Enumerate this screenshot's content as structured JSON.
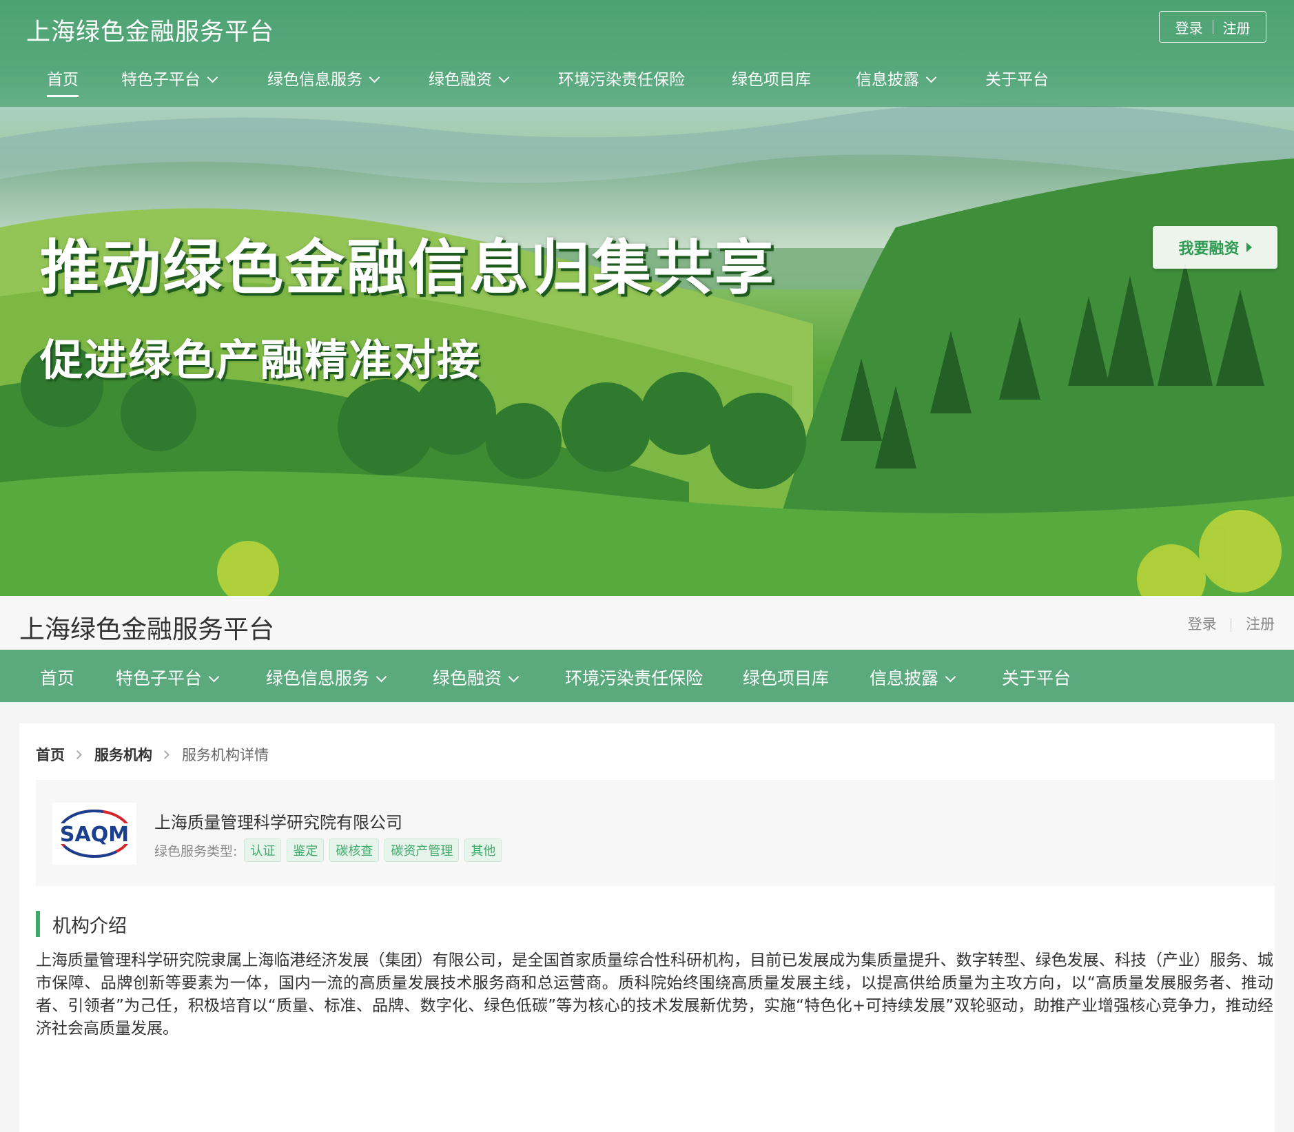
{
  "site": {
    "title": "上海绿色金融服务平台",
    "login": "登录",
    "register": "注册"
  },
  "nav": {
    "items": [
      {
        "label": "首页",
        "dropdown": false
      },
      {
        "label": "特色子平台",
        "dropdown": true
      },
      {
        "label": "绿色信息服务",
        "dropdown": true
      },
      {
        "label": "绿色融资",
        "dropdown": true
      },
      {
        "label": "环境污染责任保险",
        "dropdown": false
      },
      {
        "label": "绿色项目库",
        "dropdown": false
      },
      {
        "label": "信息披露",
        "dropdown": true
      },
      {
        "label": "关于平台",
        "dropdown": false
      }
    ],
    "active": "首页"
  },
  "hero": {
    "slogan_main": "推动绿色金融信息归集共享",
    "slogan_sub": "促进绿色产融精准对接",
    "cta": "我要融资"
  },
  "breadcrumb": [
    "首页",
    "服务机构",
    "服务机构详情"
  ],
  "org": {
    "logo_text": "SAQM",
    "name": "上海质量管理科学研究院有限公司",
    "service_type_label": "绿色服务类型:",
    "tags": [
      "认证",
      "鉴定",
      "碳核查",
      "碳资产管理",
      "其他"
    ]
  },
  "intro": {
    "title": "机构介绍",
    "body": "上海质量管理科学研究院隶属上海临港经济发展（集团）有限公司，是全国首家质量综合性科研机构，目前已发展成为集质量提升、数字转型、绿色发展、科技（产业）服务、城市保障、品牌创新等要素为一体，国内一流的高质量发展技术服务商和总运营商。质科院始终围绕高质量发展主线，以提高供给质量为主攻方向，以“高质量发展服务者、推动者、引领者”为己任，积极培育以“质量、标准、品牌、数字化、绿色低碳”等为核心的技术发展新优势，实施“特色化+可持续发展”双轮驱动，助推产业增强核心竞争力，推动经济社会高质量发展。"
  },
  "colors": {
    "brand_green": "#5aaa7e",
    "accent_green": "#3fa968",
    "logo_blue": "#1b3f8f",
    "logo_red": "#d6262b"
  }
}
